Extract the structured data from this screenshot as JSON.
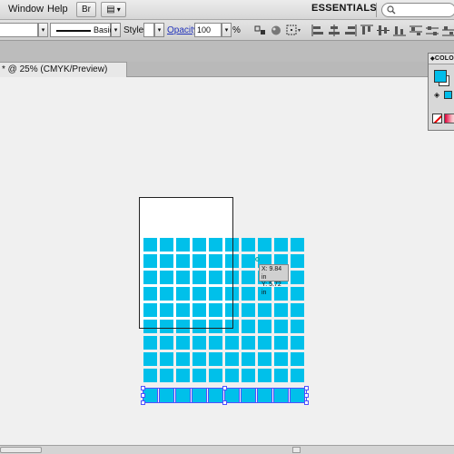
{
  "menubar": {
    "items": [
      "Window",
      "Help"
    ],
    "bridge_label": "Br",
    "arrange_label": "▤",
    "arrange_arrow": "▾",
    "workspace": "ESSENTIALS",
    "workspace_arrow": "▼",
    "search_icon": "search-icon",
    "search_placeholder": ""
  },
  "controlbar": {
    "stroke_profile": "Basic",
    "style_label": "Style:",
    "opacity_label": "Opacity:",
    "opacity_value": "100",
    "opacity_unit": "%",
    "dropdown_arrow": "▾"
  },
  "document_tab": {
    "title": "* @ 25% (CMYK/Preview)",
    "close_glyph": "×"
  },
  "color_panel": {
    "title": "COLO",
    "fill_color": "#00bdea",
    "stroke_color": "#ffffff"
  },
  "tooltip": {
    "x": "X: 9.84 in",
    "y": "Y: 5.72 in"
  },
  "colors": {
    "tile": "#00c0ea",
    "selection": "#5050ff"
  }
}
